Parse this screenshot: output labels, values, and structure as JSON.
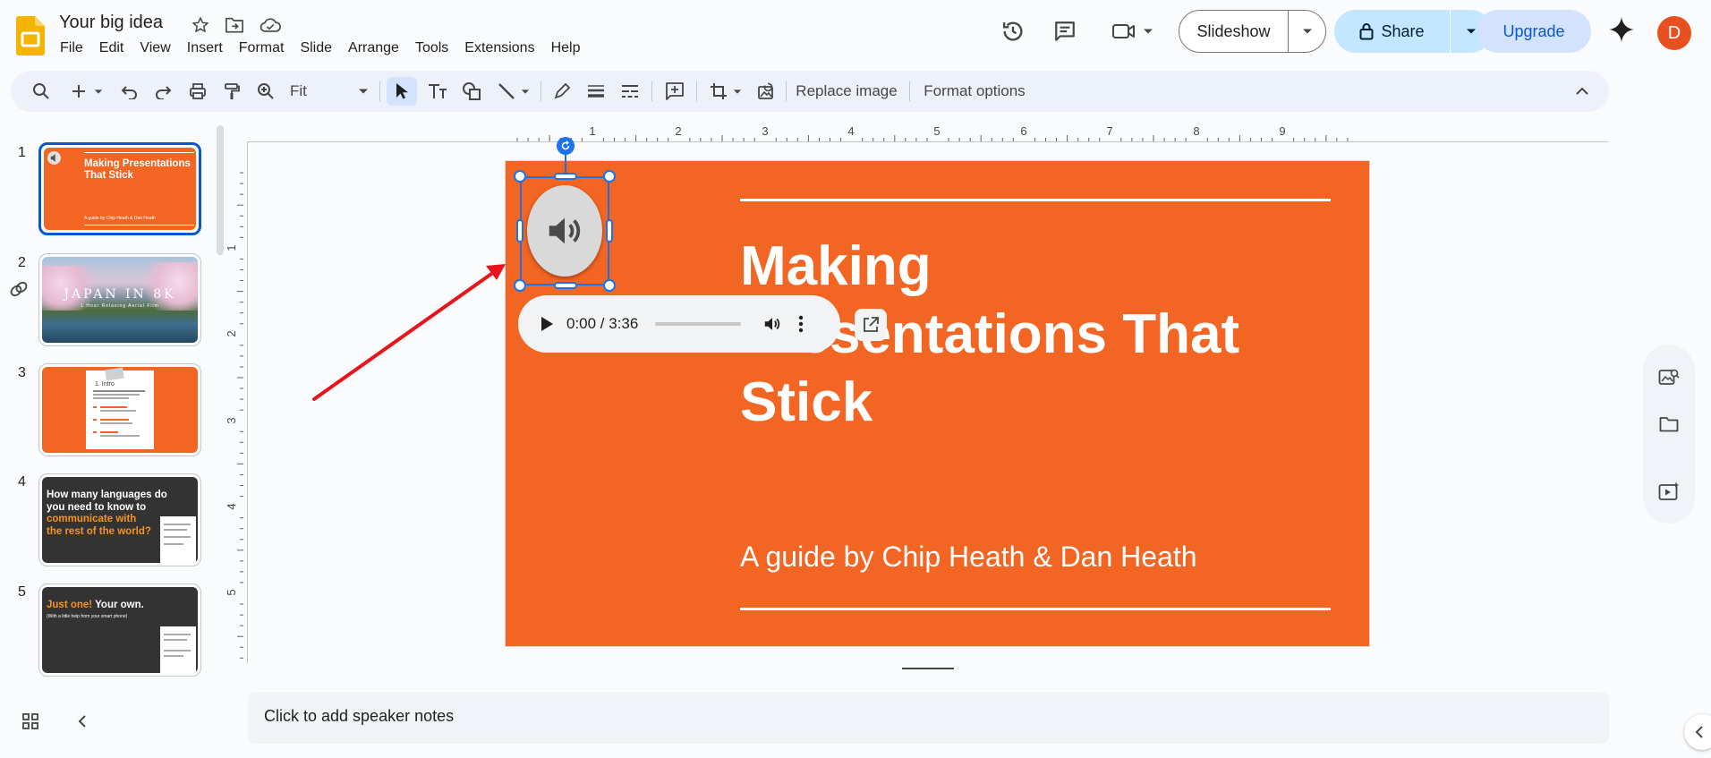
{
  "app": {
    "doc_title": "Your big idea",
    "menu": [
      "File",
      "Edit",
      "View",
      "Insert",
      "Format",
      "Slide",
      "Arrange",
      "Tools",
      "Extensions",
      "Help"
    ],
    "slideshow_label": "Slideshow",
    "share_label": "Share",
    "upgrade_label": "Upgrade",
    "avatar_letter": "D"
  },
  "toolbar": {
    "zoom_value": "Fit",
    "replace_image_label": "Replace image",
    "format_options_label": "Format options"
  },
  "slides_panel": {
    "numbers": [
      "1",
      "2",
      "3",
      "4",
      "5"
    ],
    "thumb1": {
      "title": "Making Presentations That Stick",
      "subtitle": "A guide by Chip Heath & Dan Heath"
    },
    "thumb2": {
      "title": "JAPAN IN 8K",
      "subtitle": "1 Hour Relaxing Aerial Film"
    },
    "thumb3": {
      "title": "1. Intro"
    },
    "thumb4": {
      "line1": "How many languages do",
      "line2": "you need to know to",
      "line3": "communicate with",
      "line4": "the rest of the world?"
    },
    "thumb5": {
      "accent": "Just one!",
      "rest": " Your own.",
      "sub": "(With a little help from your smart phone)"
    }
  },
  "ruler": {
    "h_labels": [
      "1",
      "2",
      "3",
      "4",
      "5",
      "6",
      "7",
      "8",
      "9"
    ],
    "v_labels": [
      "1",
      "2",
      "3",
      "4",
      "5"
    ]
  },
  "slide": {
    "title_line1": "Making",
    "title_line2": "Presentations That",
    "title_line3": "Stick",
    "subtitle": "A guide by Chip Heath & Dan Heath",
    "background_color": "#f26522"
  },
  "audio_player": {
    "time_display": "0:00 / 3:36",
    "progress": 0.0
  },
  "speaker_notes_placeholder": "Click to add speaker notes",
  "colors": {
    "accent_orange": "#f26522",
    "selection_blue": "#1a73e8",
    "annotation_arrow": "#e8131b"
  }
}
